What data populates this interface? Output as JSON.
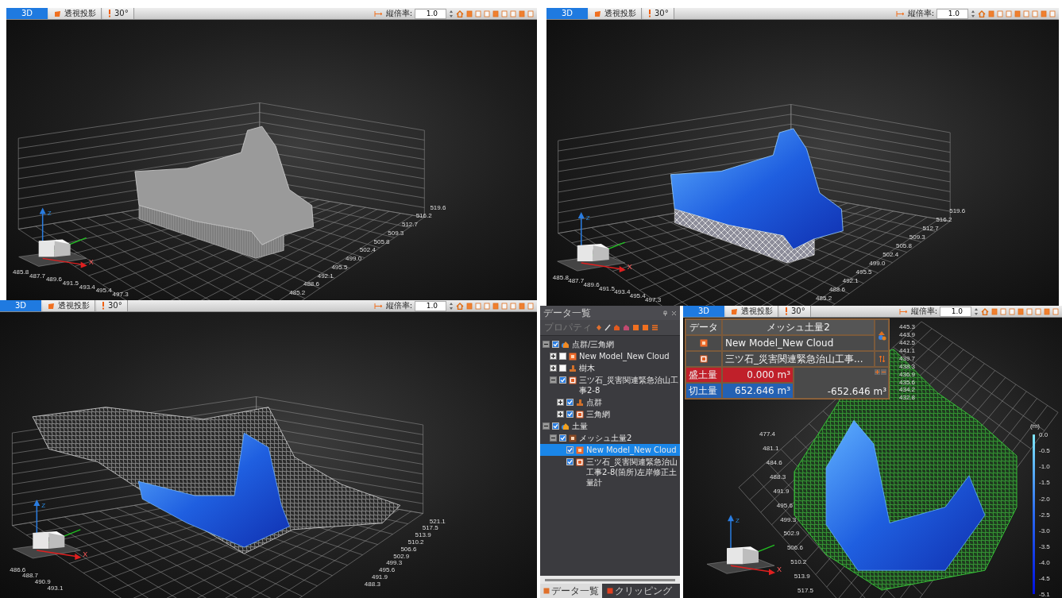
{
  "views": [
    {
      "toolbar": {
        "tab": "3D",
        "projection": "透視投影",
        "angle": "30°",
        "scale_label": "縦倍率:",
        "scale_value": "1.0"
      },
      "scene": {
        "kind": "solid",
        "front_ticks": [
          "485.8",
          "487.7",
          "489.6",
          "491.5",
          "493.4",
          "495.4",
          "497.3"
        ],
        "right_ticks": [
          "519.6",
          "516.2",
          "512.7",
          "509.3",
          "505.8",
          "502.4",
          "499.0",
          "495.5",
          "492.1",
          "488.6",
          "485.2"
        ],
        "gizmo": [
          "Z",
          "X"
        ]
      }
    },
    {
      "toolbar": {
        "tab": "3D",
        "projection": "透視投影",
        "angle": "30°",
        "scale_label": "縦倍率:",
        "scale_value": "1.0"
      },
      "scene": {
        "kind": "blue_mesh",
        "front_ticks": [
          "485.8",
          "487.7",
          "489.6",
          "491.5",
          "493.4",
          "495.4",
          "497.3"
        ],
        "right_ticks": [
          "519.6",
          "516.2",
          "512.7",
          "509.3",
          "505.8",
          "502.4",
          "499.0",
          "495.5",
          "492.1",
          "488.6",
          "485.2"
        ],
        "gizmo": [
          "Z",
          "X"
        ]
      }
    },
    {
      "toolbar": {
        "tab": "3D",
        "projection": "透視投影",
        "angle": "30°",
        "scale_label": "縦倍率:",
        "scale_value": "1.0"
      },
      "scene": {
        "kind": "wire",
        "front_ticks": [
          "486.6",
          "488.7",
          "490.9",
          "493.1"
        ],
        "right_ticks": [
          "521.1",
          "517.5",
          "513.9",
          "510.2",
          "506.6",
          "502.9",
          "499.3",
          "495.6",
          "491.9",
          "488.3"
        ],
        "gizmo": [
          "Z",
          "X"
        ]
      }
    },
    {
      "toolbar": {
        "tab": "3D",
        "projection": "透視投影",
        "angle": "30°",
        "scale_label": "縦倍率:",
        "scale_value": "1.0"
      },
      "scene": {
        "kind": "green",
        "top_ticks": [
          "445.3",
          "443.9",
          "442.5",
          "441.1",
          "439.7",
          "438.3",
          "436.9",
          "435.6",
          "434.2",
          "432.8"
        ],
        "left_ticks": [
          "477.4",
          "481.1",
          "484.6",
          "488.3",
          "491.9",
          "495.6",
          "499.3",
          "502.9",
          "506.6",
          "510.2",
          "513.9",
          "517.5"
        ],
        "gizmo": [
          "Z",
          "X"
        ],
        "legend": {
          "unit": "(m)",
          "ticks": [
            "0.0",
            "-0.5",
            "-1.0",
            "-1.5",
            "-2.0",
            "-2.5",
            "-3.0",
            "-3.5",
            "-4.0",
            "-4.5",
            "-5.1"
          ]
        }
      }
    }
  ],
  "data_panel": {
    "title": "データ一覧",
    "property_button": {
      "label": "プロパティ",
      "disabled": true
    },
    "tree": [
      {
        "kind": "group",
        "label": "点群/三角網",
        "checked": true,
        "expanded": true,
        "selected": false,
        "children": [
          {
            "kind": "model",
            "label": "New Model_New Cloud",
            "checked": false,
            "expanded": false,
            "selected": false
          },
          {
            "kind": "tree",
            "label": "樹木",
            "checked": false,
            "expanded": false,
            "selected": false
          },
          {
            "kind": "doc",
            "label": "三ツ石_災害関連緊急治山工事2-8",
            "checked": true,
            "expanded": true,
            "selected": false,
            "children": [
              {
                "kind": "tree",
                "label": "点群",
                "checked": true,
                "expanded": false,
                "selected": false
              },
              {
                "kind": "doc",
                "label": "三角網",
                "checked": true,
                "expanded": false,
                "selected": false
              }
            ]
          }
        ]
      },
      {
        "kind": "volume",
        "label": "土量",
        "checked": true,
        "expanded": true,
        "selected": false,
        "children": [
          {
            "kind": "mesh",
            "label": "メッシュ土量2",
            "checked": true,
            "expanded": true,
            "selected": false,
            "children": [
              {
                "kind": "model",
                "label": "New Model_New Cloud",
                "checked": true,
                "selected": true
              },
              {
                "kind": "doc",
                "label": "三ツ石_災害関連緊急治山工事2-8(箇所)左岸修正土量計",
                "checked": true,
                "selected": false
              }
            ]
          }
        ]
      }
    ],
    "tabs": [
      {
        "label": "データ一覧",
        "selected": true
      },
      {
        "label": "クリッピング",
        "selected": false
      }
    ]
  },
  "volume_popup": {
    "header": "データ",
    "name": "メッシュ土量2",
    "sources": [
      {
        "kind": "model",
        "label": "New Model_New Cloud"
      },
      {
        "kind": "doc",
        "label": "三ツ石_災害関連緊急治山工事..."
      }
    ],
    "fill": {
      "label": "盛土量",
      "value": "0.000 m³"
    },
    "cut": {
      "label": "切土量",
      "value": "652.646 m³"
    },
    "net": "-652.646 m³"
  }
}
